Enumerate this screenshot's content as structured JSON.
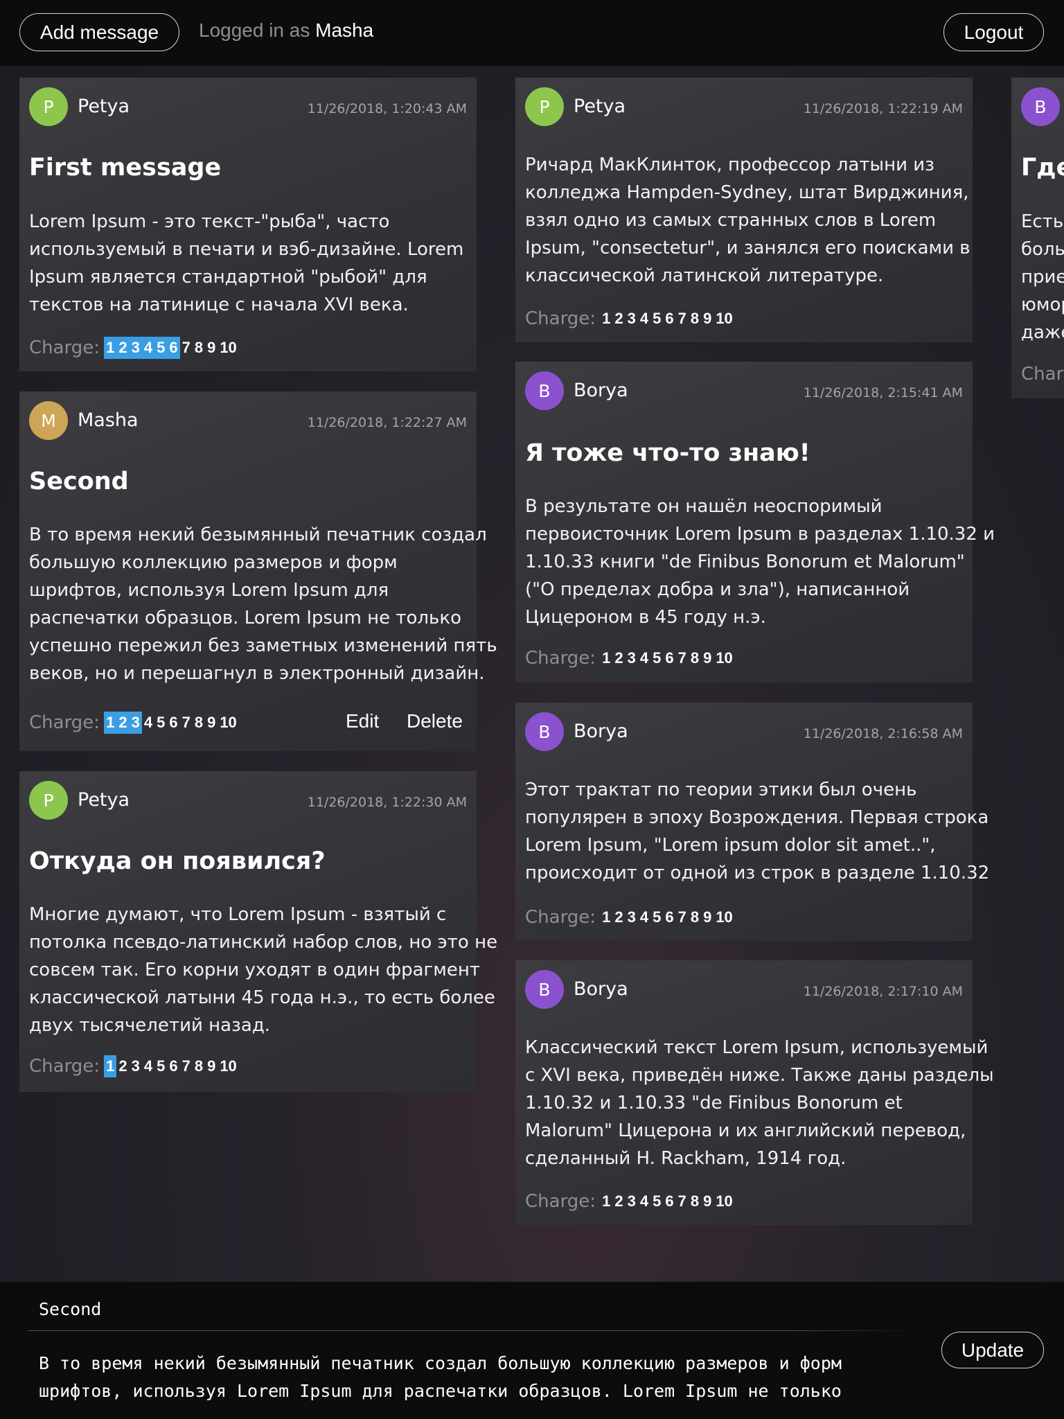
{
  "header": {
    "add_button": "Add message",
    "logged_in_label": "Logged in as",
    "username": "Masha",
    "logout_button": "Logout"
  },
  "charge_label": "Charge:",
  "charge_scale": [
    "1",
    "2",
    "3",
    "4",
    "5",
    "6",
    "7",
    "8",
    "9",
    "10"
  ],
  "messages": [
    {
      "author": "Petya",
      "initial": "P",
      "avatar_color": "#8dc64d",
      "date": "11/26/2018, 1:20:43 AM",
      "title": "First message",
      "lines": [
        "Lorem Ipsum - это текст-\"рыба\", часто",
        "используемый в печати и вэб-дизайне. Lorem",
        "Ipsum является стандартной \"рыбой\" для",
        "текстов на латинице с начала XVI века."
      ],
      "charge": 6
    },
    {
      "author": "Masha",
      "initial": "M",
      "avatar_color": "#cda556",
      "date": "11/26/2018, 1:22:27 AM",
      "title": "Second",
      "lines": [
        "В то время некий безымянный печатник создал",
        "большую коллекцию размеров и форм",
        "шрифтов, используя Lorem Ipsum для",
        "распечатки образцов. Lorem Ipsum не только",
        "успешно пережил без заметных изменений пять",
        "веков, но и перешагнул в электронный дизайн."
      ],
      "charge": 3,
      "edit_label": "Edit",
      "delete_label": "Delete"
    },
    {
      "author": "Petya",
      "initial": "P",
      "avatar_color": "#8dc64d",
      "date": "11/26/2018, 1:22:30 AM",
      "title": "Откуда он появился?",
      "lines": [
        "Многие думают, что Lorem Ipsum - взятый с",
        "потолка псевдо-латинский набор слов, но это не",
        "совсем так. Его корни уходят в один фрагмент",
        "классической латыни 45 года н.э., то есть более",
        "двух тысячелетий назад."
      ],
      "charge": 1
    },
    {
      "author": "Petya",
      "initial": "P",
      "avatar_color": "#8dc64d",
      "date": "11/26/2018, 1:22:19 AM",
      "title": "",
      "lines": [
        "Ричард МакКлинток, профессор латыни из",
        "колледжа Hampden-Sydney, штат Вирджиния,",
        "взял одно из самых странных слов в Lorem",
        "Ipsum, \"consectetur\", и занялся его поисками в",
        "классической латинской литературе."
      ],
      "charge": 0
    },
    {
      "author": "Borya",
      "initial": "B",
      "avatar_color": "#8a52cf",
      "date": "11/26/2018, 2:15:41 AM",
      "title": "Я тоже что-то знаю!",
      "lines": [
        "В результате он нашёл неоспоримый",
        "первоисточник Lorem Ipsum в разделах 1.10.32 и",
        "1.10.33 книги \"de Finibus Bonorum et Malorum\"",
        "(\"О пределах добра и зла\"), написанной",
        "Цицероном в 45 году н.э."
      ],
      "charge": 0
    },
    {
      "author": "Borya",
      "initial": "B",
      "avatar_color": "#8a52cf",
      "date": "11/26/2018, 2:16:58 AM",
      "title": "",
      "lines": [
        "Этот трактат по теории этики был очень",
        "популярен в эпоху Возрождения. Первая строка",
        "Lorem Ipsum, \"Lorem ipsum dolor sit amet..\",",
        "происходит от одной из строк в разделе 1.10.32"
      ],
      "charge": 0
    },
    {
      "author": "Borya",
      "initial": "B",
      "avatar_color": "#8a52cf",
      "date": "11/26/2018, 2:17:10 AM",
      "title": "",
      "lines": [
        "Классический текст Lorem Ipsum, используемый",
        "с XVI века, приведён ниже. Также даны разделы",
        "1.10.32 и 1.10.33 \"de Finibus Bonorum et",
        "Malorum\" Цицерона и их английский перевод,",
        "сделанный H. Rackham, 1914 год."
      ],
      "charge": 0
    },
    {
      "author": "",
      "initial": "B",
      "avatar_color": "#8a52cf",
      "date": "",
      "title": "Где",
      "lines": [
        "Есть",
        "боль",
        "прие",
        "юмор",
        "даже"
      ],
      "charge": 0,
      "charge_label_partial": "Charg"
    }
  ],
  "editor": {
    "title_value": "Second",
    "body_lines": [
      "В то время некий безымянный печатник создал большую коллекцию размеров и форм",
      "шрифтов, используя Lorem Ipsum для распечатки образцов. Lorem Ipsum не только"
    ],
    "update_button": "Update"
  }
}
